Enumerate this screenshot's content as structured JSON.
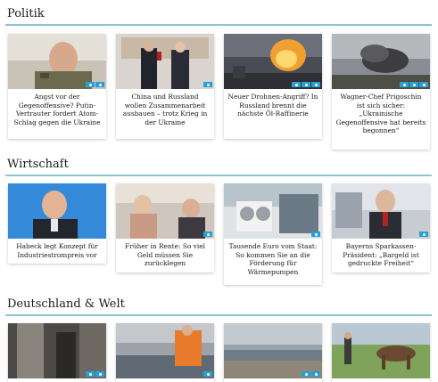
{
  "sections": [
    {
      "title": "Politik",
      "articles": [
        {
          "caption": "Angst vor der Gegenoffensive? Putin-Vertrauter fordert Atom-Schlag gegen die Ukraine",
          "icon": "video-icon"
        },
        {
          "caption": "China und Russland wollen Zusammenarbeit ausbauen – trotz Krieg in der Ukraine",
          "icon": "video-icon"
        },
        {
          "caption": "Neuer Drohnen-Angriff? In Russland brennt die nächste Öl-Raffinerie",
          "icon": "video-icon"
        },
        {
          "caption": "Wagner-Chef Prigoschin ist sich sicher: „Ukrainische Gegenoffensive hat bereits begonnen“",
          "icon": "video-icon"
        }
      ]
    },
    {
      "title": "Wirtschaft",
      "articles": [
        {
          "caption": "Habeck legt Konzept für Industriestrompreis vor",
          "icon": "video-icon"
        },
        {
          "caption": "Früher in Rente: So viel Geld müssen Sie zurücklegen",
          "icon": "video-icon"
        },
        {
          "caption": "Tausende Euro vom Staat: So kommen Sie an die Förderung für Wärmepumpen",
          "icon": "video-icon"
        },
        {
          "caption": "Bayerns Sparkassen-Präsident: „Bargeld ist gedruckte Freiheit“",
          "icon": "video-icon"
        }
      ]
    },
    {
      "title": "Deutschland & Welt",
      "articles": [
        {
          "caption": "",
          "icon": "video-icon"
        },
        {
          "caption": "",
          "icon": "video-icon"
        },
        {
          "caption": "",
          "icon": "video-icon"
        },
        {
          "caption": "",
          "icon": "video-icon"
        }
      ]
    }
  ],
  "colors": {
    "rule": "#8fc3d6",
    "badge": "#2a9fd6"
  }
}
